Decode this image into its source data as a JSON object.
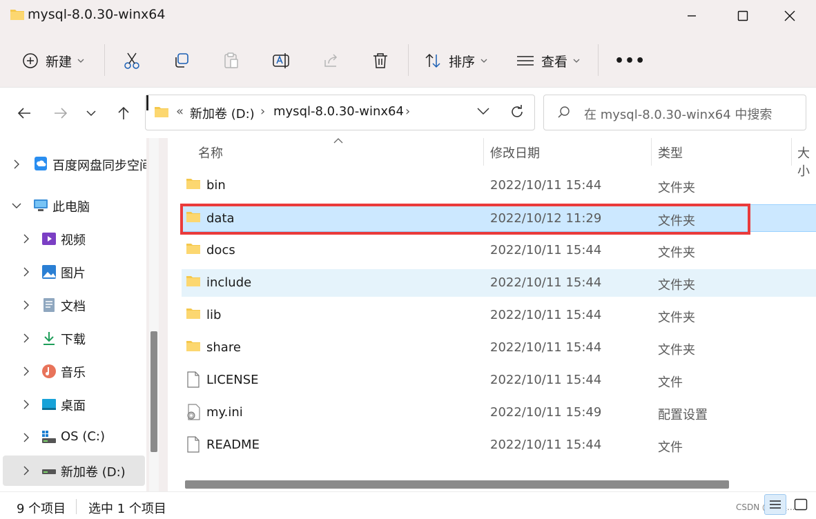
{
  "window": {
    "title": "mysql-8.0.30-winx64"
  },
  "toolbar": {
    "new_label": "新建",
    "sort_label": "排序",
    "view_label": "查看",
    "more_label": "•••"
  },
  "address": {
    "overflow": "«",
    "crumbs": [
      "新加卷 (D:)",
      "mysql-8.0.30-winx64"
    ],
    "separator": "›"
  },
  "search": {
    "placeholder": "在 mysql-8.0.30-winx64 中搜索"
  },
  "sidebar": {
    "items": [
      {
        "label": "百度网盘同步空间",
        "icon": "cloud-sync-icon"
      },
      {
        "label": "此电脑",
        "icon": "computer-icon"
      },
      {
        "label": "视频",
        "icon": "video-icon"
      },
      {
        "label": "图片",
        "icon": "picture-icon"
      },
      {
        "label": "文档",
        "icon": "document-icon"
      },
      {
        "label": "下载",
        "icon": "download-icon"
      },
      {
        "label": "音乐",
        "icon": "music-icon"
      },
      {
        "label": "桌面",
        "icon": "desktop-icon"
      },
      {
        "label": "OS (C:)",
        "icon": "drive-icon"
      },
      {
        "label": "新加卷 (D:)",
        "icon": "drive-icon"
      }
    ]
  },
  "columns": {
    "name": "名称",
    "modified": "修改日期",
    "type": "类型",
    "size": "大小"
  },
  "files": [
    {
      "name": "bin",
      "modified": "2022/10/11 15:44",
      "type": "文件夹",
      "icon": "folder-icon"
    },
    {
      "name": "data",
      "modified": "2022/10/12 11:29",
      "type": "文件夹",
      "icon": "folder-icon"
    },
    {
      "name": "docs",
      "modified": "2022/10/11 15:44",
      "type": "文件夹",
      "icon": "folder-icon"
    },
    {
      "name": "include",
      "modified": "2022/10/11 15:44",
      "type": "文件夹",
      "icon": "folder-icon"
    },
    {
      "name": "lib",
      "modified": "2022/10/11 15:44",
      "type": "文件夹",
      "icon": "folder-icon"
    },
    {
      "name": "share",
      "modified": "2022/10/11 15:44",
      "type": "文件夹",
      "icon": "folder-icon"
    },
    {
      "name": "LICENSE",
      "modified": "2022/10/11 15:44",
      "type": "文件",
      "icon": "file-icon"
    },
    {
      "name": "my.ini",
      "modified": "2022/10/11 15:49",
      "type": "配置设置",
      "icon": "settings-file-icon"
    },
    {
      "name": "README",
      "modified": "2022/10/11 15:44",
      "type": "文件",
      "icon": "file-icon"
    }
  ],
  "status": {
    "count": "9 个项目",
    "selected": "选中 1 个项目"
  },
  "watermark": "CSDN @白晨..."
}
